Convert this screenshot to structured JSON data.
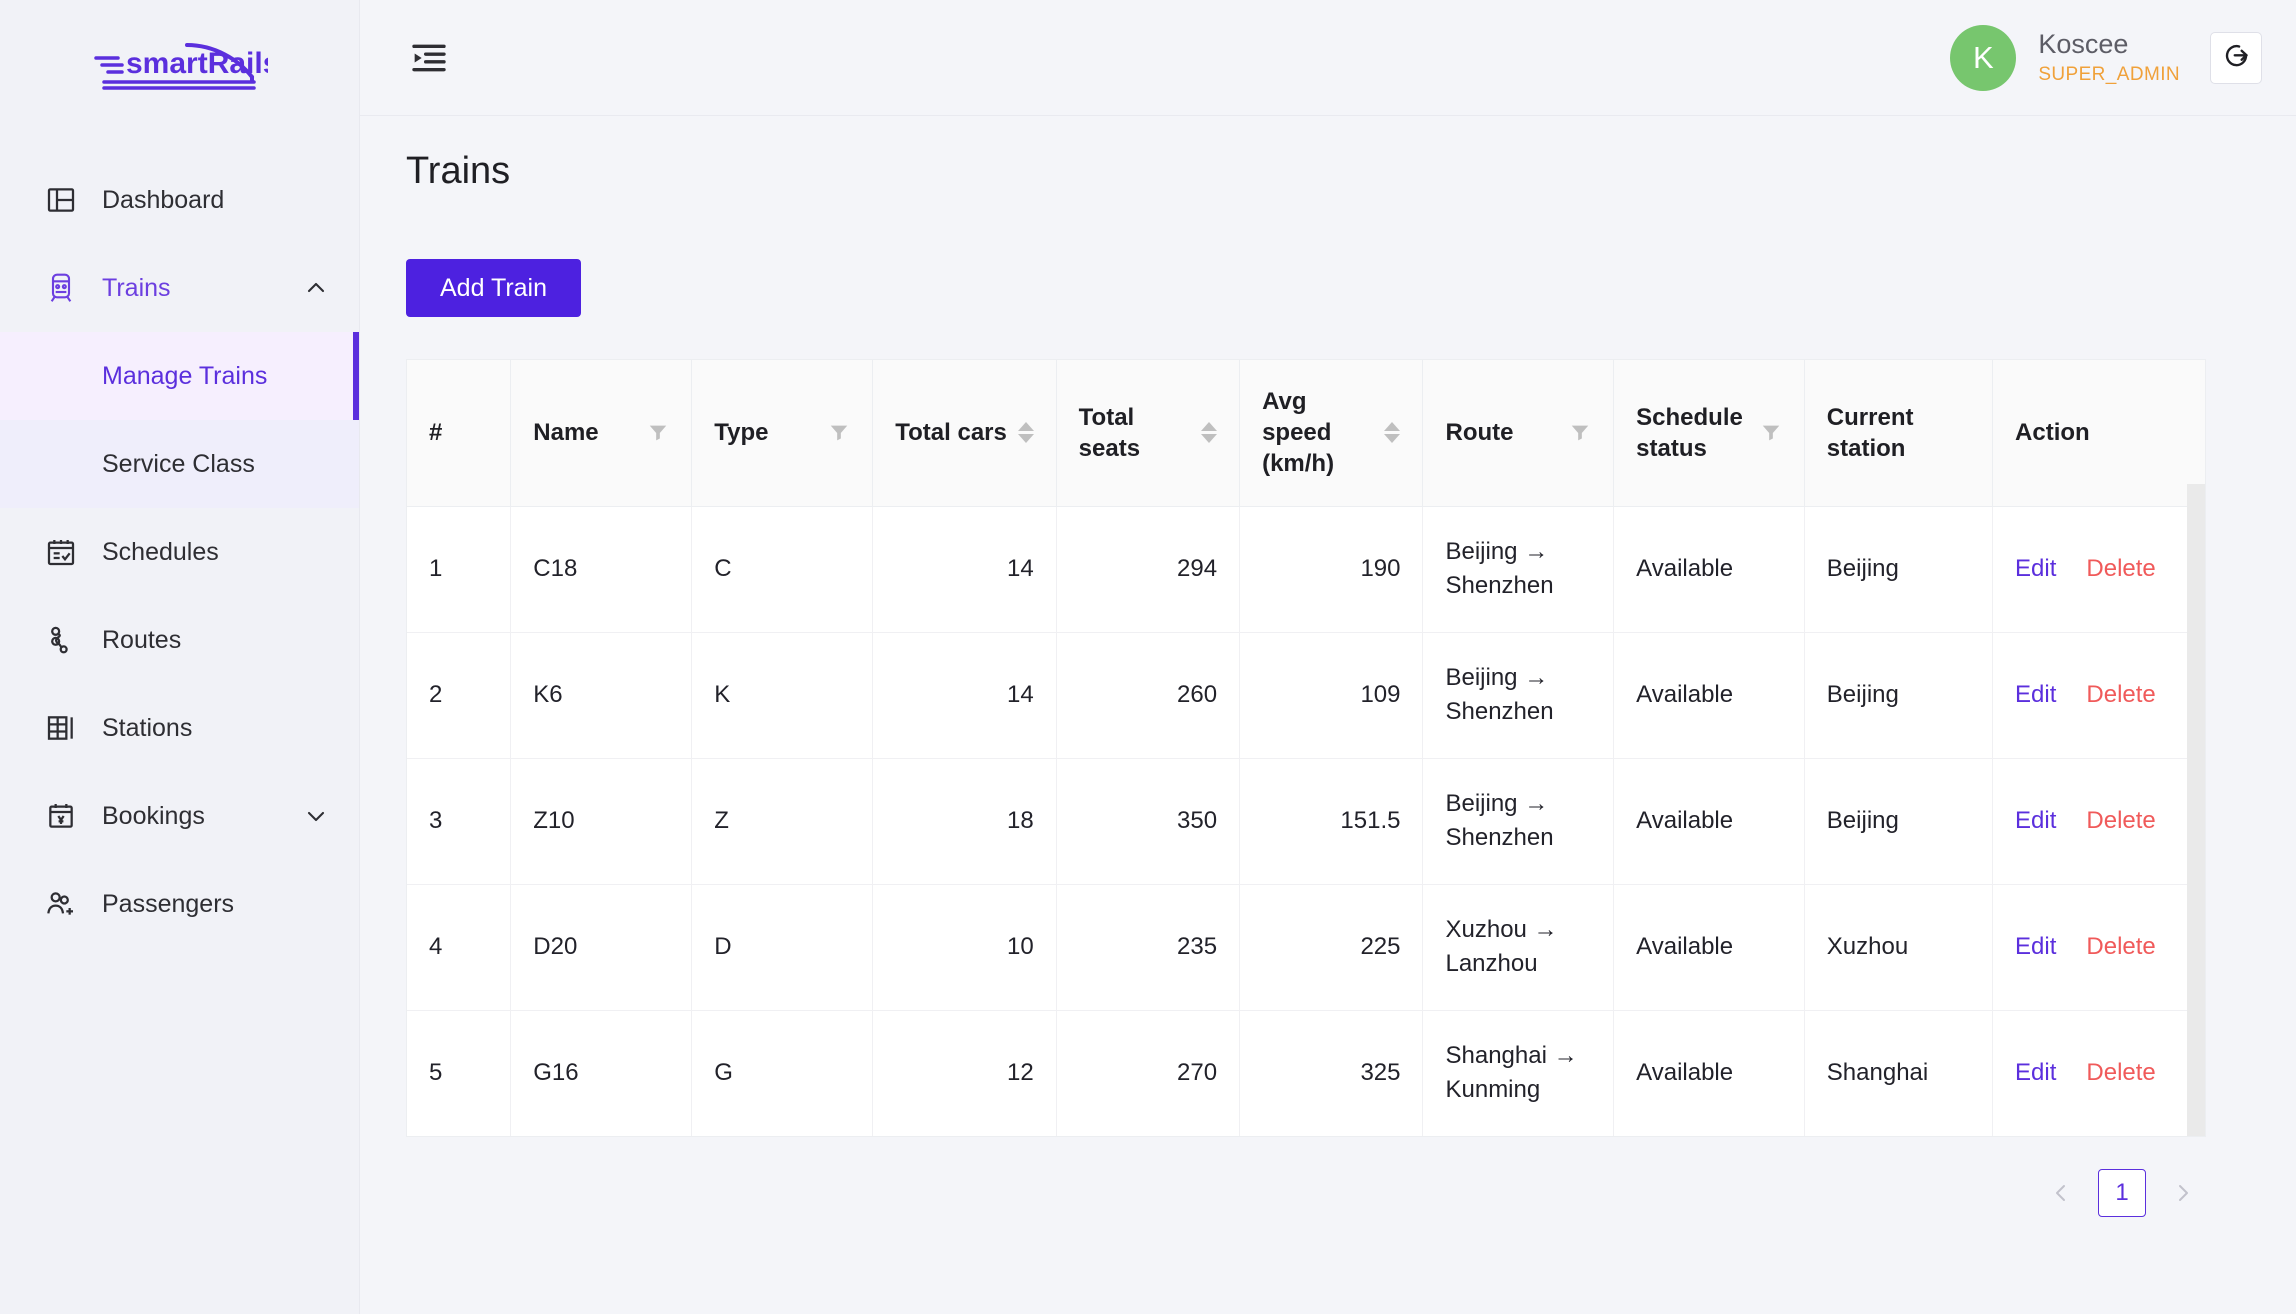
{
  "brand": {
    "name": "smartRails",
    "logo_icon": "train-speedlines-logo",
    "color": "#5b2fdd"
  },
  "sidebar": {
    "items": [
      {
        "label": "Dashboard",
        "icon": "layout-dashboard-icon",
        "active": false,
        "expandable": false
      },
      {
        "label": "Trains",
        "icon": "train-icon",
        "active": true,
        "expandable": true,
        "chevron": "chevron-up-icon"
      },
      {
        "label": "Schedules",
        "icon": "calendar-check-icon",
        "active": false,
        "expandable": false
      },
      {
        "label": "Routes",
        "icon": "route-nodes-icon",
        "active": false,
        "expandable": false
      },
      {
        "label": "Stations",
        "icon": "station-grid-icon",
        "active": false,
        "expandable": false
      },
      {
        "label": "Bookings",
        "icon": "calendar-ticket-icon",
        "active": false,
        "expandable": true,
        "chevron": "chevron-down-icon"
      },
      {
        "label": "Passengers",
        "icon": "user-add-icon",
        "active": false,
        "expandable": false
      }
    ],
    "submenu": [
      {
        "label": "Manage Trains",
        "active": true
      },
      {
        "label": "Service Class",
        "active": false
      }
    ],
    "active_submenu_accent": "#5b2fdd"
  },
  "topbar": {
    "fold_icon": "menu-fold-icon",
    "user": {
      "initial": "K",
      "name": "Koscee",
      "role": "SUPER_ADMIN",
      "avatar_color": "#77c66e",
      "role_color": "#f0a13a"
    },
    "logout_icon": "logout-icon"
  },
  "page": {
    "title": "Trains",
    "add_button": "Add Train",
    "add_button_color": "#4d21e0"
  },
  "table": {
    "columns": [
      {
        "label": "#",
        "key": "index",
        "align": "left",
        "filter": false,
        "sort": false
      },
      {
        "label": "Name",
        "key": "name",
        "align": "left",
        "filter": true,
        "sort": false
      },
      {
        "label": "Type",
        "key": "type",
        "align": "left",
        "filter": true,
        "sort": false
      },
      {
        "label": "Total cars",
        "key": "total_cars",
        "align": "right",
        "filter": false,
        "sort": true
      },
      {
        "label": "Total seats",
        "key": "total_seats",
        "align": "right",
        "filter": false,
        "sort": true
      },
      {
        "label": "Avg speed (km/h)",
        "key": "avg_speed",
        "align": "right",
        "filter": false,
        "sort": true
      },
      {
        "label": "Route",
        "key": "route",
        "align": "left",
        "filter": true,
        "sort": false
      },
      {
        "label": "Schedule status",
        "key": "schedule_status",
        "align": "left",
        "filter": true,
        "sort": false
      },
      {
        "label": "Current station",
        "key": "current_station",
        "align": "left",
        "filter": false,
        "sort": false
      },
      {
        "label": "Action",
        "key": "action",
        "align": "left",
        "filter": false,
        "sort": false
      }
    ],
    "rows": [
      {
        "index": "1",
        "name": "C18",
        "type": "C",
        "total_cars": "14",
        "total_seats": "294",
        "avg_speed": "190",
        "route_from": "Beijing",
        "route_to": "Shenzhen",
        "schedule_status": "Available",
        "current_station": "Beijing"
      },
      {
        "index": "2",
        "name": "K6",
        "type": "K",
        "total_cars": "14",
        "total_seats": "260",
        "avg_speed": "109",
        "route_from": "Beijing",
        "route_to": "Shenzhen",
        "schedule_status": "Available",
        "current_station": "Beijing"
      },
      {
        "index": "3",
        "name": "Z10",
        "type": "Z",
        "total_cars": "18",
        "total_seats": "350",
        "avg_speed": "151.5",
        "route_from": "Beijing",
        "route_to": "Shenzhen",
        "schedule_status": "Available",
        "current_station": "Beijing"
      },
      {
        "index": "4",
        "name": "D20",
        "type": "D",
        "total_cars": "10",
        "total_seats": "235",
        "avg_speed": "225",
        "route_from": "Xuzhou",
        "route_to": "Lanzhou",
        "schedule_status": "Available",
        "current_station": "Xuzhou"
      },
      {
        "index": "5",
        "name": "G16",
        "type": "G",
        "total_cars": "12",
        "total_seats": "270",
        "avg_speed": "325",
        "route_from": "Shanghai",
        "route_to": "Kunming",
        "schedule_status": "Available",
        "current_station": "Shanghai"
      }
    ],
    "route_arrow": "→",
    "actions": {
      "edit": "Edit",
      "delete": "Delete",
      "edit_color": "#5b2fdd",
      "delete_color": "#f05a5a"
    },
    "filter_icon": "filter-icon",
    "sort_icon": "sort-arrows-icon"
  },
  "pagination": {
    "prev_icon": "chevron-left-icon",
    "next_icon": "chevron-right-icon",
    "pages": [
      "1"
    ],
    "current": "1",
    "accent": "#5b2fdd"
  }
}
